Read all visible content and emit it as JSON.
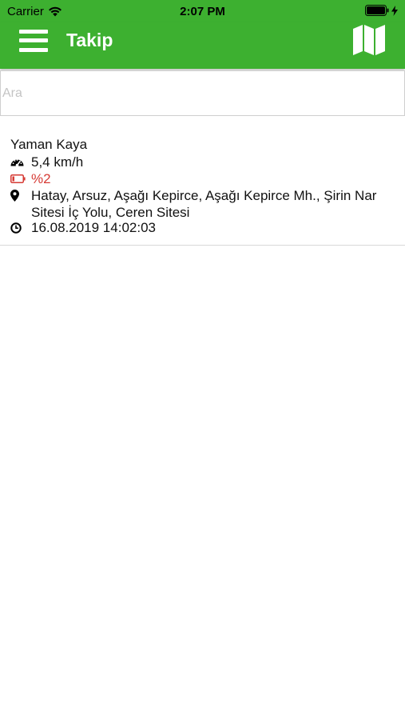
{
  "status_bar": {
    "carrier": "Carrier",
    "time": "2:07 PM"
  },
  "header": {
    "title": "Takip",
    "menu_icon": "hamburger-menu-icon",
    "map_icon": "map-icon"
  },
  "search": {
    "placeholder": "Ara",
    "value": ""
  },
  "trackers": [
    {
      "name": "Yaman Kaya",
      "speed": "5,4 km/h",
      "battery": "%2",
      "address": "Hatay, Arsuz, Aşağı Kepirce, Aşağı Kepirce Mh., Şirin Nar Sitesi İç Yolu, Ceren Sitesi",
      "datetime": "16.08.2019 14:02:03"
    }
  ],
  "colors": {
    "accent": "#3db030",
    "battery_low": "#d63b35"
  }
}
